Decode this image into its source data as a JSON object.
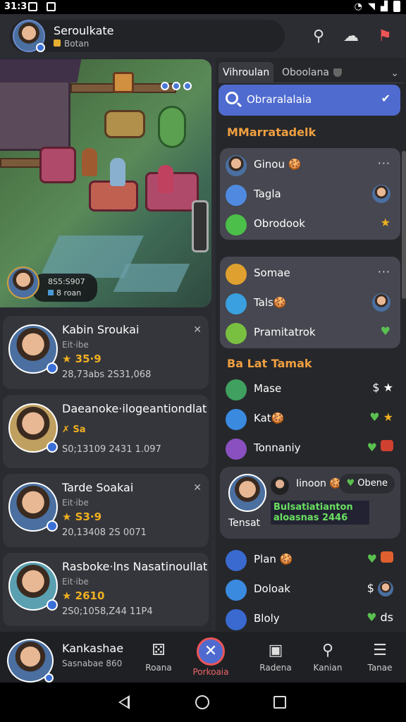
{
  "status": {
    "time": "31:3"
  },
  "header": {
    "user_name": "Seroulkate",
    "user_sub": "Botan"
  },
  "game": {
    "player_score": "8S5:S907",
    "player_sub": "8 roan"
  },
  "friends": [
    {
      "name": "Kabin Sroukai",
      "sub": "Eit·ibe",
      "rating": "35·9",
      "score": "28,73abs 2S31,068"
    },
    {
      "name": "Daeanoke·ilogeantiondlat",
      "sub": "",
      "rating": "Sa",
      "score": "S0;13109 2431 1.097"
    },
    {
      "name": "Tarde Soakai",
      "sub": "Eit·ibe",
      "rating": "S3·9",
      "score": "20,13408 2S 0071"
    },
    {
      "name": "Rasboke·lns Nasatinoullat",
      "sub": "Eit·ibe",
      "rating": "2610",
      "score": "2S0;1058,Z44 11P4"
    }
  ],
  "right": {
    "tabs": [
      "Vihroulan",
      "Oboolana"
    ],
    "search_text": "Obraralalaia",
    "section1": "MMarratadelk",
    "card1": [
      {
        "label": "Ginou",
        "extra": "···"
      },
      {
        "label": "Tagla",
        "extra": ""
      },
      {
        "label": "Obrodook",
        "extra": "★"
      }
    ],
    "card2": [
      {
        "label": "Somae",
        "extra": "···"
      },
      {
        "label": "Tals",
        "extra": ""
      },
      {
        "label": "Pramitatrok",
        "extra": ""
      }
    ],
    "section2": "Ba Lat Tamak",
    "list1": [
      {
        "label": "Mase",
        "extra": "$ ★"
      },
      {
        "label": "Kat",
        "extra": "★"
      },
      {
        "label": "Tonnaniy",
        "extra": ""
      }
    ],
    "chat": {
      "name": "Iinoon",
      "pill": "Obene",
      "message": "Bulsatiatianton aloasnas 2446",
      "label": "Tensat"
    },
    "list2": [
      {
        "label": "Plan",
        "extra": ""
      },
      {
        "label": "Doloak",
        "extra": "$"
      },
      {
        "label": "Bloly",
        "extra": "ds"
      }
    ]
  },
  "bottom": {
    "name": "Kankashae",
    "sub": "Sasnabae 860",
    "nav": [
      "Roana",
      "Porkoaia",
      "Radena",
      "Kanian",
      "Tanae"
    ]
  }
}
